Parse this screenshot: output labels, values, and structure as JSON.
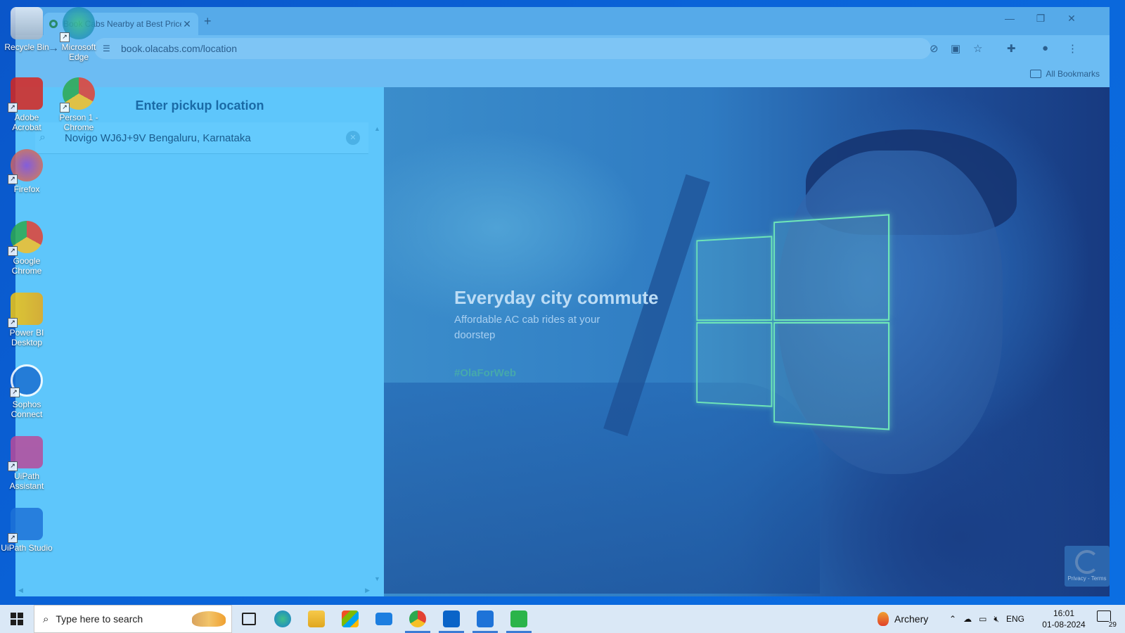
{
  "browser": {
    "tab_title": "Book Cabs Nearby at Best Price",
    "url": "book.olacabs.com/location",
    "all_bookmarks": "All Bookmarks"
  },
  "pickup": {
    "title": "Enter pickup location",
    "value": "Novigo WJ6J+9V Bengaluru, Karnataka"
  },
  "hero": {
    "headline": "Everyday city commute",
    "subtitle": "Affordable AC cab rides at your doorstep",
    "hashtag": "#OlaForWeb"
  },
  "recaptcha": {
    "text": "Privacy - Terms"
  },
  "desktop_icons": [
    {
      "label": "Recycle Bin"
    },
    {
      "label": "Microsoft Edge"
    },
    {
      "label": "Adobe Acrobat"
    },
    {
      "label": "Person 1 - Chrome"
    },
    {
      "label": "Firefox"
    },
    {
      "label": "Google Chrome"
    },
    {
      "label": "Power BI Desktop"
    },
    {
      "label": "Sophos Connect"
    },
    {
      "label": "UiPath Assistant"
    },
    {
      "label": "UiPath Studio"
    }
  ],
  "taskbar": {
    "search_placeholder": "Type here to search",
    "weather": "Archery",
    "language": "ENG",
    "time": "16:01",
    "date": "01-08-2024",
    "notifications": "29"
  },
  "colors": {
    "taskbar_bg": "#dae8f6",
    "pickup_title": "#1a6aa6",
    "hashtag": "#4fbf9a",
    "desktop_bg": "#0a63d8"
  }
}
